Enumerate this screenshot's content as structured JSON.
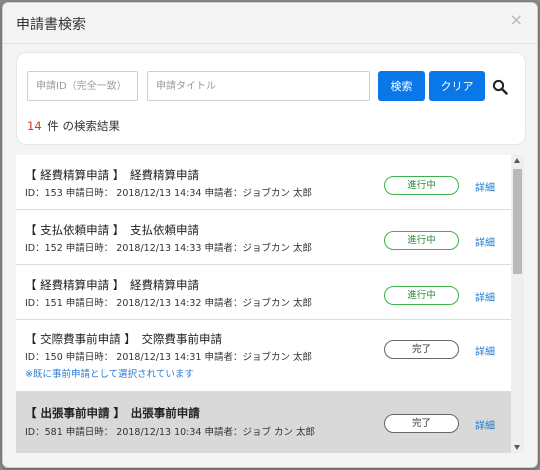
{
  "dialog": {
    "title": "申請書検索",
    "close_label": "×"
  },
  "search": {
    "id_placeholder": "申請ID（完全一致）",
    "title_placeholder": "申請タイトル",
    "search_button": "検索",
    "clear_button": "クリア",
    "icon": "search-icon"
  },
  "results": {
    "count": "14",
    "count_suffix": "件 の検索結果"
  },
  "items": [
    {
      "title": "【 経費精算申請 】　経費精算申請",
      "meta": "ID：153 申請日時： 2018/12/13 14:34 申請者：ジョブカン 太郎",
      "status": "進行中",
      "status_color": "#3bb24a",
      "detail": "詳細"
    },
    {
      "title": "【 支払依頼申請 】　支払依頼申請",
      "meta": "ID：152 申請日時： 2018/12/13 14:33 申請者：ジョブカン 太郎",
      "status": "進行中",
      "status_color": "#3bb24a",
      "detail": "詳細"
    },
    {
      "title": "【 経費精算申請 】　経費精算申請",
      "meta": "ID：151 申請日時： 2018/12/13 14:32 申請者：ジョブカン 太郎",
      "status": "進行中",
      "status_color": "#3bb24a",
      "detail": "詳細"
    },
    {
      "title": "【 交際費事前申請 】　交際費事前申請",
      "meta": "ID：150 申請日時： 2018/12/13 14:31 申請者：ジョブカン 太郎",
      "note": "※既に事前申請として選択されています",
      "status": "完了",
      "status_color": "#666666",
      "detail": "詳細"
    },
    {
      "title": "【 出張事前申請 】　出張事前申請",
      "meta": "ID：581 申請日時： 2018/12/13 10:34 申請者：ジョブ カン 太郎",
      "status": "完了",
      "status_color": "#666666",
      "detail": "詳細",
      "selected": true
    }
  ]
}
